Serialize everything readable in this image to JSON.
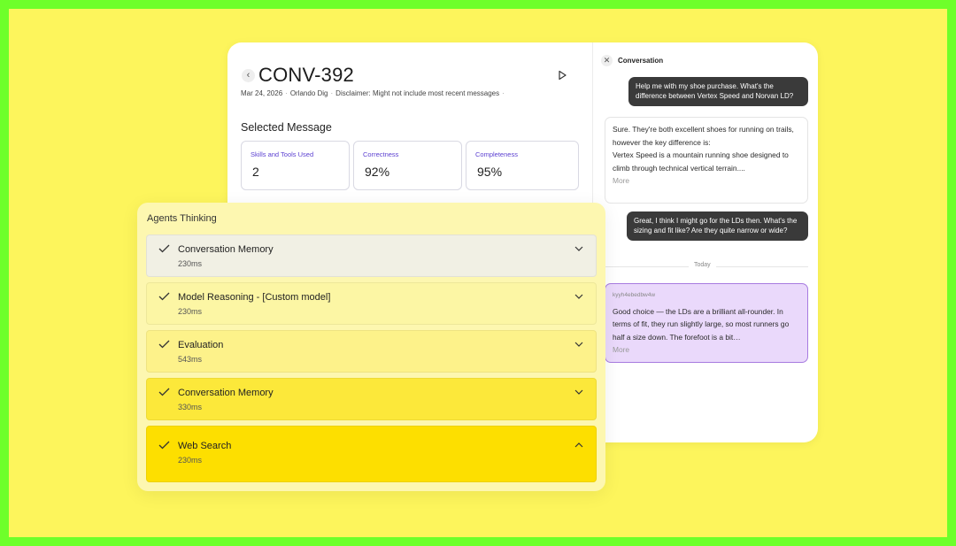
{
  "header": {
    "back_icon": "chevron-left-icon",
    "title": "CONV-392",
    "play_icon": "play-icon",
    "date": "Mar 24, 2026",
    "user": "Orlando Dig",
    "disclaimer": "Disclaimer: Might not include most recent messages"
  },
  "selected_message": {
    "title": "Selected Message",
    "metrics": [
      {
        "label": "Skills and Tools Used",
        "value": "2"
      },
      {
        "label": "Correctness",
        "value": "92%"
      },
      {
        "label": "Completeness",
        "value": "95%"
      }
    ]
  },
  "conversation": {
    "close_icon": "close-icon",
    "title": "Conversation",
    "messages": [
      {
        "role": "user",
        "text": "Help me with my shoe purchase. What's the difference between Vertex Speed and Norvan LD?"
      },
      {
        "role": "agent",
        "text1": "Sure. They're both excellent shoes for running on trails, however the key difference is:",
        "text2": "Vertex Speed is a mountain running shoe designed to climb through technical vertical terrain....",
        "more": "More"
      },
      {
        "role": "user",
        "text": "Great, I think I might go for the LDs then. What's the sizing and fit like? Are they quite narrow or wide?"
      },
      {
        "role": "agent",
        "id": "kyyh4ebedbw4w",
        "text": "Good choice — the LDs are a brilliant all-rounder. In terms of fit, they run slightly large, so most runners go half a size down. The forefoot is a bit…",
        "more": "More"
      }
    ],
    "divider": "Today"
  },
  "thinking": {
    "title": "Agents Thinking",
    "steps": [
      {
        "name": "Conversation Memory",
        "time": "230ms",
        "color": "#f1f0e4",
        "expanded": false
      },
      {
        "name": "Model Reasoning - [Custom model]",
        "time": "230ms",
        "color": "#fcf6a4",
        "expanded": false
      },
      {
        "name": "Evaluation",
        "time": "543ms",
        "color": "#fdf28a",
        "expanded": false
      },
      {
        "name": "Conversation Memory",
        "time": "330ms",
        "color": "#fce83a",
        "expanded": false
      },
      {
        "name": "Web Search",
        "time": "230ms",
        "color": "#fddf00",
        "expanded": true
      }
    ]
  },
  "colors": {
    "frame": "#6eff2a",
    "background": "#fdf55c",
    "accent": "#5b3fd1",
    "highlight_bubble": "#ead9fb"
  }
}
